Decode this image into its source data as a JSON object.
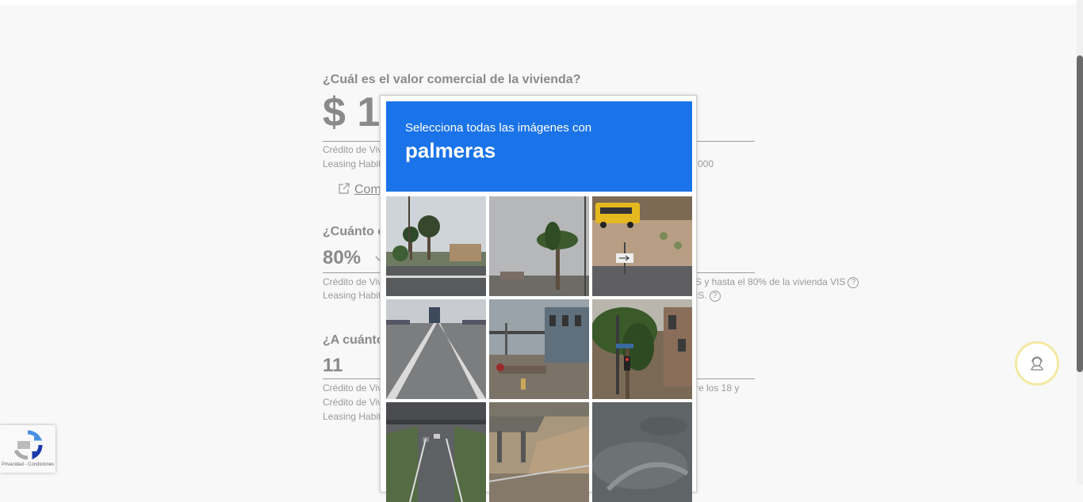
{
  "form": {
    "q1": {
      "label": "¿Cuál es el valor comercial de la vivienda?",
      "value": "$ 1",
      "note1": "Crédito de Viv",
      "note2": "Leasing Habit",
      "note2_tail": "000",
      "link": "Com"
    },
    "q2": {
      "label": "¿Cuánto c",
      "value": "80%",
      "note1": "Crédito de Viv",
      "note1_tail": "S y hasta el 80% de la vivienda VIS",
      "note2": "Leasing Habit",
      "note2_tail": "IS.",
      "help": "?"
    },
    "q3": {
      "label": "¿A cuánto",
      "value": "11",
      "note1": "Crédito de Viv",
      "note1_tail": "re los 18 y",
      "note2": "Crédito de Viv",
      "note3": "Leasing Habit"
    }
  },
  "captcha": {
    "instruction": "Selecciona todas las imágenes con",
    "target": "palmeras",
    "header_color": "#1a73e8",
    "tiles": [
      {
        "subject": "palm trees by road with houses"
      },
      {
        "subject": "single palm tree under cloudy sky"
      },
      {
        "subject": "school bus on road with arrow sign"
      },
      {
        "subject": "highway with truck"
      },
      {
        "subject": "waterfront street with bridge"
      },
      {
        "subject": "palm tree with traffic light and buildings"
      },
      {
        "subject": "highway underpass"
      },
      {
        "subject": "bridge over dirt embankment"
      },
      {
        "subject": "blurred dark texture"
      }
    ]
  },
  "recaptcha": {
    "text": "Privacidad - Condiciones",
    "icon": "recaptcha-logo-icon"
  },
  "support": {
    "icon": "support-agent-icon",
    "ring_color": "#f4e9a2"
  }
}
